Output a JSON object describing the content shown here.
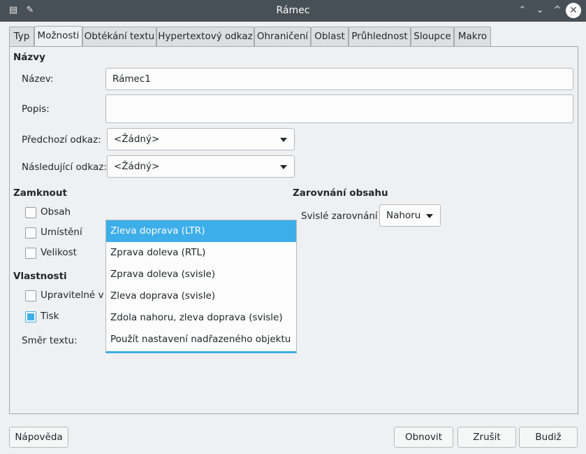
{
  "window": {
    "title": "Rámec",
    "buttons": [
      "keep-above",
      "minimize",
      "maximize",
      "close"
    ]
  },
  "tabs": [
    "Typ",
    "Možnosti",
    "Obtékání textu",
    "Hypertextový odkaz",
    "Ohraničení",
    "Oblast",
    "Průhlednost",
    "Sloupce",
    "Makro"
  ],
  "active_tab": "Možnosti",
  "names": {
    "heading": "Názvy",
    "name_label": "Název:",
    "name_value": "Rámec1",
    "desc_label": "Popis:",
    "desc_value": "",
    "prev_label": "Předchozí odkaz:",
    "prev_value": "<Žádný>",
    "next_label": "Následující odkaz:",
    "next_value": "<Žádný>"
  },
  "lock": {
    "heading": "Zamknout",
    "content": {
      "label": "Obsah",
      "checked": false
    },
    "position": {
      "label": "Umístění",
      "checked": false
    },
    "size": {
      "label": "Velikost",
      "checked": false
    }
  },
  "align": {
    "heading": "Zarovnání obsahu",
    "vertical_label": "Svislé zarovnání",
    "vertical_value": "Nahoru"
  },
  "properties": {
    "heading": "Vlastnosti",
    "editable": {
      "label": "Upravitelné v d",
      "checked": false
    },
    "print": {
      "label": "Tisk",
      "checked": true
    },
    "direction_label": "Směr textu:"
  },
  "direction_dropdown": {
    "options": [
      "Zleva doprava (LTR)",
      "Zprava doleva (RTL)",
      "Zprava doleva (svisle)",
      "Zleva doprava (svisle)",
      "Zdola nahoru, zleva doprava (svisle)",
      "Použít nastavení nadřazeného objektu"
    ],
    "selected": "Zleva doprava (LTR)"
  },
  "footer": {
    "help": "Nápověda",
    "reset": "Obnovit",
    "cancel": "Zrušit",
    "ok": "Budiž"
  },
  "colors": {
    "accent": "#3daee9",
    "titlebar": "#475057",
    "background": "#eff0f1"
  }
}
